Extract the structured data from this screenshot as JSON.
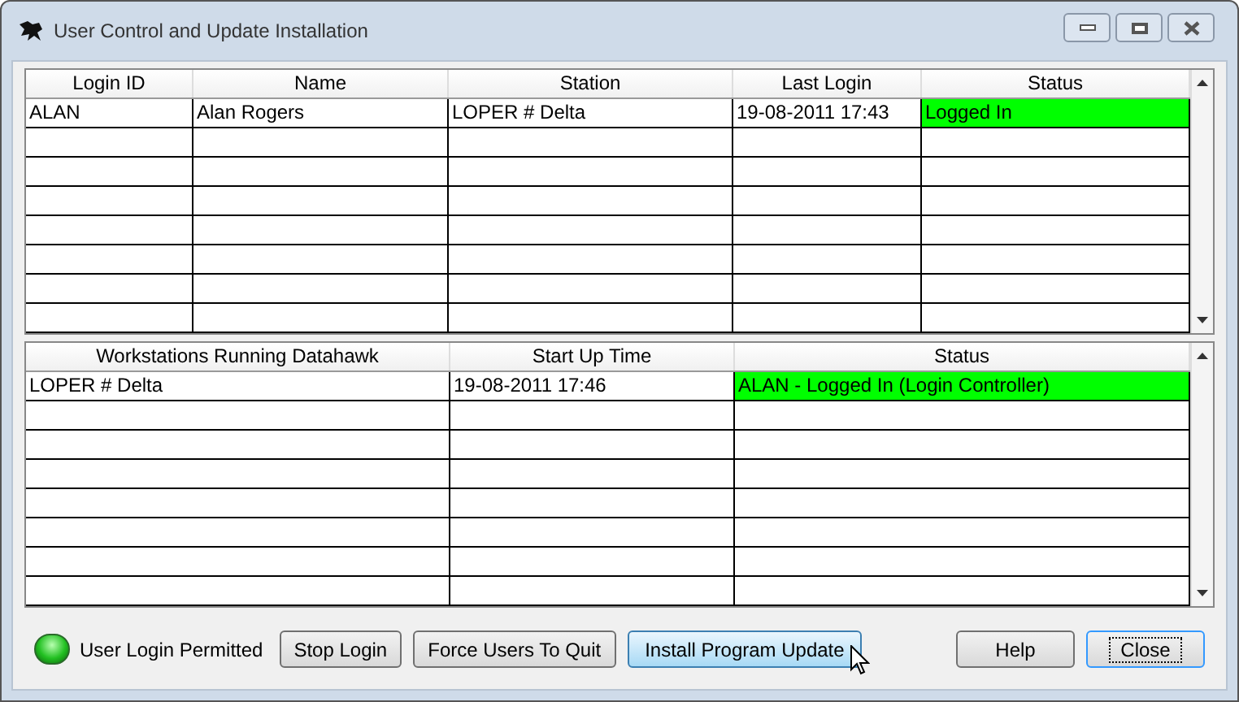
{
  "window": {
    "title": "User Control and Update Installation"
  },
  "users_table": {
    "columns": [
      "Login ID",
      "Name",
      "Station",
      "Last Login",
      "Status"
    ],
    "rows": [
      {
        "cells": [
          "ALAN",
          "Alan Rogers",
          "LOPER # Delta",
          "19-08-2011 17:43",
          "Logged In"
        ],
        "color": "#00ff00"
      }
    ]
  },
  "workstations_table": {
    "columns": [
      "Workstations Running Datahawk",
      "Start Up Time",
      "Status"
    ],
    "rows": [
      {
        "cells": [
          "LOPER # Delta",
          "19-08-2011 17:46",
          "ALAN - Logged In (Login Controller)"
        ],
        "color": "#00ff00"
      }
    ]
  },
  "login_indicator": {
    "on": true,
    "label": "User Login Permitted"
  },
  "buttons": [
    {
      "label": "Stop Login",
      "hover": false,
      "focused": false
    },
    {
      "label": "Force Users To Quit",
      "hover": false,
      "focused": false
    },
    {
      "label": "Install Program Update",
      "hover": true,
      "focused": false
    },
    {
      "label": "Help",
      "hover": false,
      "focused": false
    },
    {
      "label": "Close",
      "hover": false,
      "focused": true
    }
  ]
}
